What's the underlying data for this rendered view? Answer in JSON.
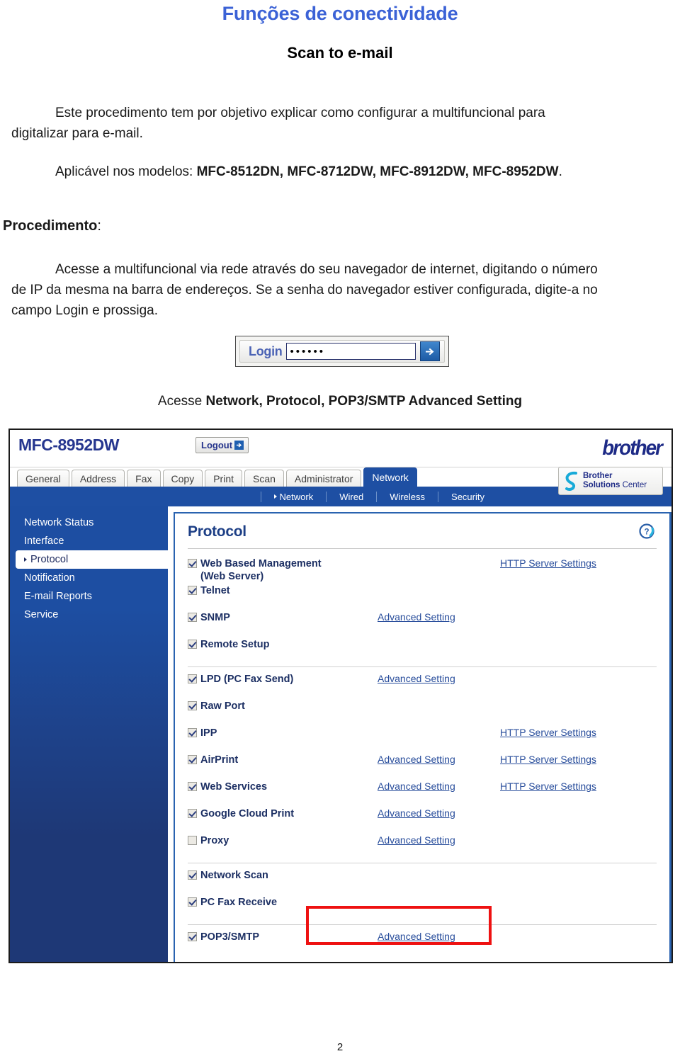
{
  "document": {
    "title": "Funções de conectividade",
    "section_title": "Scan to e-mail",
    "intro_paragraph": "Este procedimento tem por objetivo explicar como configurar a multifuncional para digitalizar para e-mail.",
    "models_prefix": "Aplicável nos modelos: ",
    "models_list": "MFC-8512DN, MFC-8712DW, MFC-8912DW, MFC-8952DW",
    "models_suffix": ".",
    "procedure_label": "Procedimento",
    "procedure_label_colon": ":",
    "procedure_paragraph": "Acesse a multifuncional via rede através do seu navegador de internet, digitando o número de IP da mesma na barra de endereços. Se a senha do navegador estiver configurada, digite-a no campo Login e prossiga.",
    "access_line_prefix": "Acesse ",
    "access_line_bold": "Network, Protocol, POP3/SMTP Advanced Setting",
    "page_number": "2",
    "title_color": "#3b62d6"
  },
  "login_widget": {
    "label": "Login",
    "password_value": "••••••",
    "password_placeholder": "",
    "submit_icon": "arrow-right-icon"
  },
  "screenshot": {
    "header": {
      "device_model": "MFC-8952DW",
      "logout_label": "Logout",
      "logout_icon": "logout-arrow-icon",
      "brand_logo": "brother",
      "solutions_line1": "Brother",
      "solutions_line2_bold": "Solutions",
      "solutions_line2_rest": " Center",
      "solutions_icon": "brother-swoosh-icon"
    },
    "tabs": [
      {
        "label": "General",
        "active": false
      },
      {
        "label": "Address",
        "active": false
      },
      {
        "label": "Fax",
        "active": false
      },
      {
        "label": "Copy",
        "active": false
      },
      {
        "label": "Print",
        "active": false
      },
      {
        "label": "Scan",
        "active": false
      },
      {
        "label": "Administrator",
        "active": false
      },
      {
        "label": "Network",
        "active": true
      }
    ],
    "subnav": [
      {
        "label": "Network",
        "active": true
      },
      {
        "label": "Wired",
        "active": false
      },
      {
        "label": "Wireless",
        "active": false
      },
      {
        "label": "Security",
        "active": false
      }
    ],
    "sidebar": [
      {
        "label": "Network Status",
        "active": false
      },
      {
        "label": "Interface",
        "active": false
      },
      {
        "label": "Protocol",
        "active": true
      },
      {
        "label": "Notification",
        "active": false
      },
      {
        "label": "E-mail Reports",
        "active": false
      },
      {
        "label": "Service",
        "active": false
      }
    ],
    "panel": {
      "title": "Protocol",
      "help_icon": "question-mark-help-icon",
      "link_advanced": "Advanced Setting",
      "link_http": "HTTP Server Settings",
      "rows": [
        {
          "label": "Web Based Management (Web Server)",
          "checked": true,
          "link_a": "",
          "link_b": "HTTP Server Settings",
          "separator": false
        },
        {
          "label": "Telnet",
          "checked": true,
          "link_a": "",
          "link_b": "",
          "separator": false
        },
        {
          "label": "SNMP",
          "checked": true,
          "link_a": "Advanced Setting",
          "link_b": "",
          "separator": false
        },
        {
          "label": "Remote Setup",
          "checked": true,
          "link_a": "",
          "link_b": "",
          "separator": false
        },
        {
          "label": "LPD (PC Fax Send)",
          "checked": true,
          "link_a": "Advanced Setting",
          "link_b": "",
          "separator": true
        },
        {
          "label": "Raw Port",
          "checked": true,
          "link_a": "",
          "link_b": "",
          "separator": false
        },
        {
          "label": "IPP",
          "checked": true,
          "link_a": "",
          "link_b": "HTTP Server Settings",
          "separator": false
        },
        {
          "label": "AirPrint",
          "checked": true,
          "link_a": "Advanced Setting",
          "link_b": "HTTP Server Settings",
          "separator": false
        },
        {
          "label": "Web Services",
          "checked": true,
          "link_a": "Advanced Setting",
          "link_b": "HTTP Server Settings",
          "separator": false
        },
        {
          "label": "Google Cloud Print",
          "checked": true,
          "link_a": "Advanced Setting",
          "link_b": "",
          "separator": false
        },
        {
          "label": "Proxy",
          "checked": false,
          "link_a": "Advanced Setting",
          "link_b": "",
          "separator": false
        },
        {
          "label": "Network Scan",
          "checked": true,
          "link_a": "",
          "link_b": "",
          "separator": true
        },
        {
          "label": "PC Fax Receive",
          "checked": true,
          "link_a": "",
          "link_b": "",
          "separator": false
        },
        {
          "label": "POP3/SMTP",
          "checked": true,
          "link_a": "Advanced Setting",
          "link_b": "",
          "separator": true
        }
      ]
    },
    "annotation": {
      "highlight_color": "#ee1111",
      "highlight_target": "POP3/SMTP row"
    }
  }
}
